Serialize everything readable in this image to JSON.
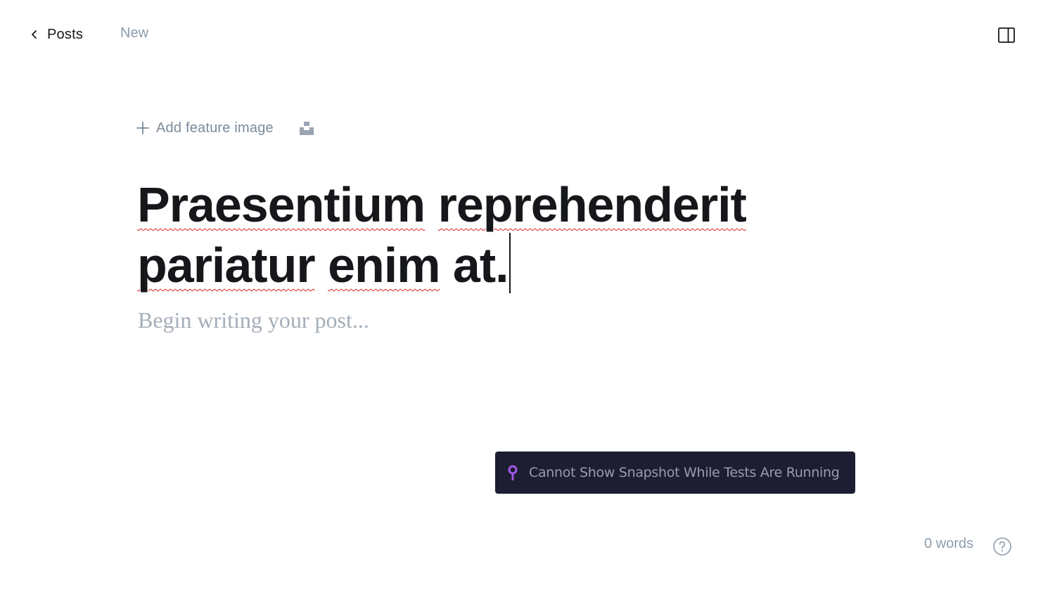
{
  "header": {
    "back_label": "Posts",
    "status_label": "New"
  },
  "feature_image": {
    "add_label": "Add feature image"
  },
  "post": {
    "title_words": [
      {
        "text": "Praesentium",
        "misspelled": true
      },
      {
        "text": "reprehenderit",
        "misspelled": true
      },
      {
        "text": "pariatur",
        "misspelled": true
      },
      {
        "text": "enim",
        "misspelled": true
      },
      {
        "text": "at.",
        "misspelled": false
      }
    ],
    "body_placeholder": "Begin writing your post..."
  },
  "toast": {
    "message": "Cannot Show Snapshot While Tests Are Running",
    "icon": "pin-icon",
    "icon_color": "#a259e6"
  },
  "footer": {
    "word_count": "0 words"
  },
  "colors": {
    "text": "#15171a",
    "muted": "#8e9cac",
    "placeholder": "#a4aeb9",
    "toast_bg": "#1e1e32",
    "spell_error": "#e02020"
  }
}
